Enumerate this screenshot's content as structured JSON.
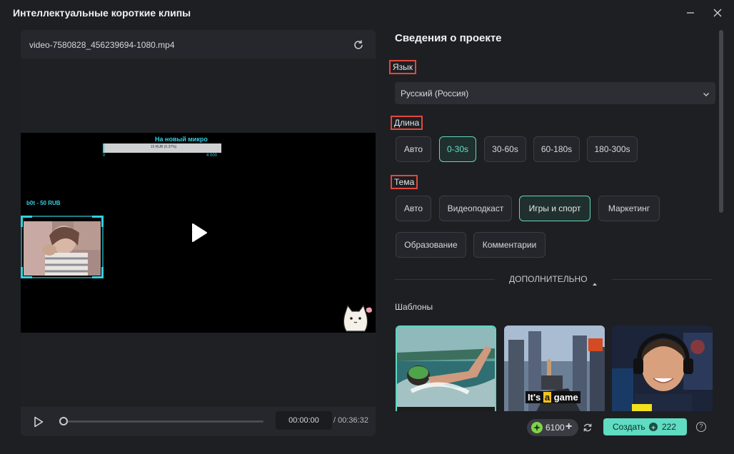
{
  "window": {
    "title": "Интеллектуальные короткие клипы"
  },
  "player": {
    "file_name": "video-7580828_456239694-1080.mp4",
    "current_time": "00:00:00",
    "total_time": "/ 00:36:32",
    "overlay": {
      "donate_title": "На новый микро",
      "donate_bar_text": "15 RUB (0.37%)",
      "donate_min": "0",
      "donate_max": "4 000",
      "last_donor": "b0t - 50 RUB"
    }
  },
  "project": {
    "section_title": "Сведения о проекте",
    "language_label": "Язык",
    "language_value": "Русский (Россия)",
    "length_label": "Длина",
    "length_options": [
      "Авто",
      "0-30s",
      "30-60s",
      "60-180s",
      "180-300s"
    ],
    "length_selected": "0-30s",
    "theme_label": "Тема",
    "theme_options": [
      "Авто",
      "Видеоподкаст",
      "Игры и спорт",
      "Маркетинг",
      "Образование",
      "Комментарии"
    ],
    "theme_selected": "Игры и спорт",
    "advanced_label": "ДОПОЛНИТЕЛЬНО",
    "templates_label": "Шаблоны",
    "template_caption": {
      "pre": "It's ",
      "highlight": "a",
      "post": " game"
    }
  },
  "footer": {
    "credits": "6100",
    "create_label": "Создать",
    "create_cost": "222",
    "help": "?"
  },
  "colors": {
    "accent": "#5fdcc2",
    "highlight_border": "#e0493c",
    "overlay_cyan": "#33d0e0"
  }
}
